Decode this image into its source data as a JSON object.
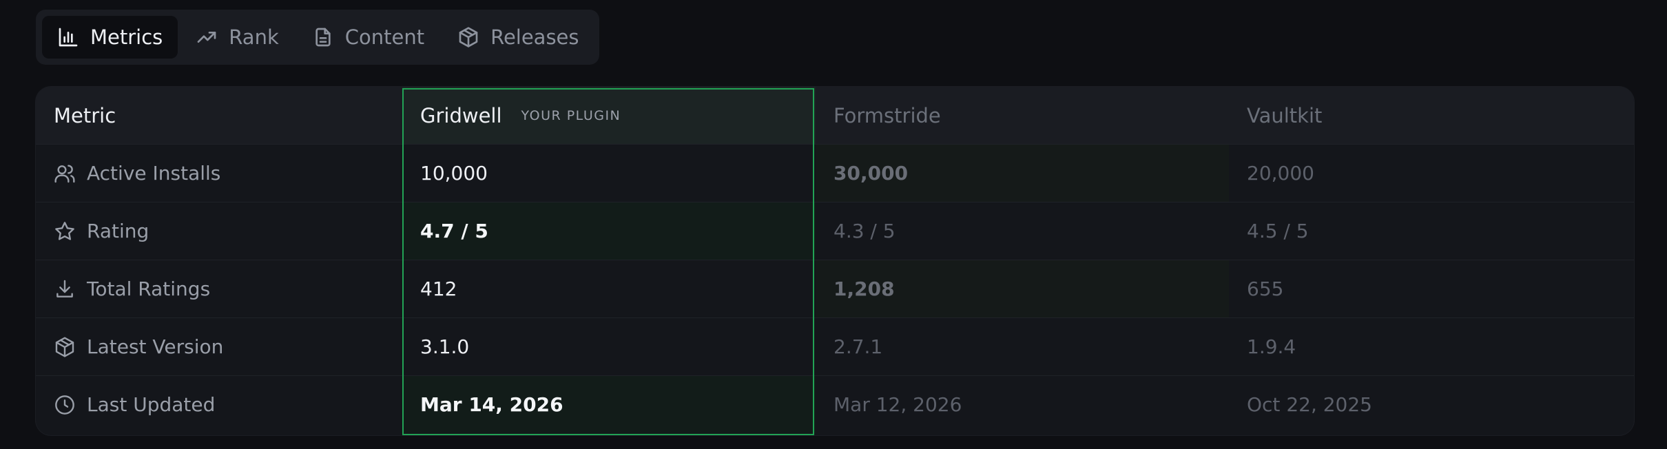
{
  "tabs": [
    {
      "label": "Metrics",
      "icon": "bar-chart-icon",
      "active": true
    },
    {
      "label": "Rank",
      "icon": "trending-up-icon",
      "active": false
    },
    {
      "label": "Content",
      "icon": "document-icon",
      "active": false
    },
    {
      "label": "Releases",
      "icon": "package-icon",
      "active": false
    }
  ],
  "table": {
    "headers": {
      "metric": "Metric",
      "plugin": "Gridwell",
      "plugin_badge": "YOUR PLUGIN",
      "competitor_1": "Formstride",
      "competitor_2": "Vaultkit"
    },
    "rows": [
      {
        "label": "Active Installs",
        "icon": "users-icon",
        "plugin": "10,000",
        "competitor_1": "30,000",
        "competitor_2": "20,000",
        "winner": "competitor_1"
      },
      {
        "label": "Rating",
        "icon": "star-icon",
        "plugin": "4.7 / 5",
        "competitor_1": "4.3 / 5",
        "competitor_2": "4.5 / 5",
        "winner": "plugin"
      },
      {
        "label": "Total Ratings",
        "icon": "download-icon",
        "plugin": "412",
        "competitor_1": "1,208",
        "competitor_2": "655",
        "winner": "competitor_1"
      },
      {
        "label": "Latest Version",
        "icon": "package-icon",
        "plugin": "3.1.0",
        "competitor_1": "2.7.1",
        "competitor_2": "1.9.4",
        "winner": ""
      },
      {
        "label": "Last Updated",
        "icon": "clock-icon",
        "plugin": "Mar 14, 2026",
        "competitor_1": "Mar 12, 2026",
        "competitor_2": "Oct 22, 2025",
        "winner": "plugin"
      }
    ]
  },
  "colors": {
    "accent": "#22a355",
    "background": "#0e0f13",
    "card": "#14161b"
  }
}
